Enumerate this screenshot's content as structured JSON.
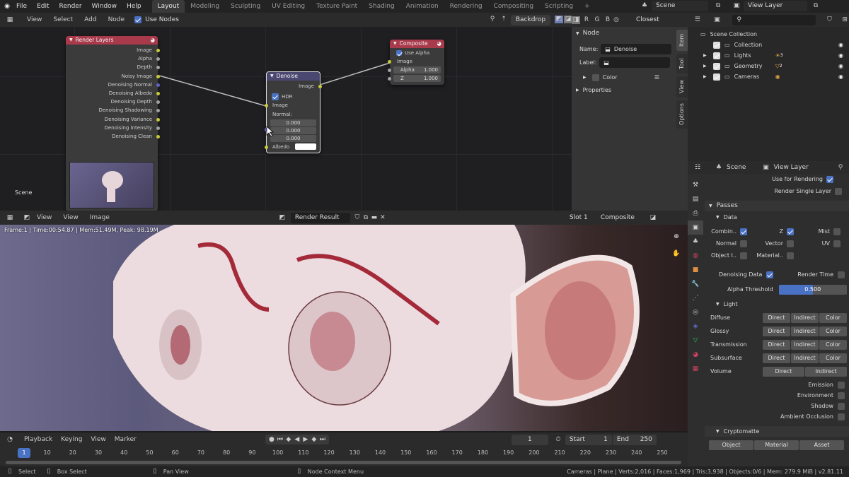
{
  "topbar": {
    "menus": [
      "File",
      "Edit",
      "Render",
      "Window",
      "Help"
    ],
    "workspaces": [
      "Layout",
      "Modeling",
      "Sculpting",
      "UV Editing",
      "Texture Paint",
      "Shading",
      "Animation",
      "Rendering",
      "Compositing",
      "Scripting"
    ],
    "active_workspace": "Layout",
    "add_tab": "+",
    "scene": "Scene",
    "view_layer": "View Layer"
  },
  "node_editor": {
    "header": {
      "menus": [
        "View",
        "Select",
        "Add",
        "Node"
      ],
      "use_nodes_label": "Use Nodes",
      "use_nodes": true,
      "backdrop_label": "Backdrop",
      "channels": [
        "R",
        "G",
        "B"
      ],
      "interpolation": "Closest"
    },
    "scene_label": "Scene",
    "render_layers": {
      "title": "Render Layers",
      "outputs": [
        {
          "label": "Image",
          "color": "yellow"
        },
        {
          "label": "Alpha",
          "color": "gray"
        },
        {
          "label": "Depth",
          "color": "gray"
        },
        {
          "label": "Noisy Image",
          "color": "yellow"
        },
        {
          "label": "Denoising Normal",
          "color": "blue"
        },
        {
          "label": "Denoising Albedo",
          "color": "yellow"
        },
        {
          "label": "Denoising Depth",
          "color": "gray"
        },
        {
          "label": "Denoising Shadowing",
          "color": "gray"
        },
        {
          "label": "Denoising Variance",
          "color": "yellow"
        },
        {
          "label": "Denoising Intensity",
          "color": "gray"
        },
        {
          "label": "Denoising Clean",
          "color": "yellow"
        }
      ]
    },
    "denoise": {
      "title": "Denoise",
      "output": "Image",
      "hdr_label": "HDR",
      "hdr": true,
      "image_label": "Image",
      "normal_label": "Normal:",
      "normal_values": [
        "0.000",
        "0.000",
        "0.000"
      ],
      "albedo_label": "Albedo"
    },
    "composite": {
      "title": "Composite",
      "use_alpha_label": "Use Alpha",
      "use_alpha": true,
      "image_label": "Image",
      "alpha_label": "Alpha",
      "alpha_value": "1.000",
      "z_label": "Z",
      "z_value": "1.000"
    }
  },
  "npanel": {
    "tabs": [
      "Item",
      "Tool",
      "View",
      "Options"
    ],
    "node_section": "Node",
    "name_label": "Name:",
    "name_value": "Denoise",
    "label_label": "Label:",
    "label_value": "",
    "color_label": "Color",
    "properties_label": "Properties"
  },
  "outliner": {
    "root": "Scene Collection",
    "items": [
      {
        "label": "Collection",
        "badge": ""
      },
      {
        "label": "Lights",
        "badge": "3"
      },
      {
        "label": "Geometry",
        "badge": "2"
      },
      {
        "label": "Cameras",
        "badge": ""
      }
    ]
  },
  "image_editor": {
    "menus": [
      "View",
      "View",
      "Image"
    ],
    "image_name": "Render Result",
    "slot": "Slot 1",
    "layer": "Composite",
    "info": "Frame:1 | Time:00:54.87 | Mem:51.49M, Peak: 98.19M"
  },
  "properties": {
    "scene_label": "Scene",
    "view_layer_label": "View Layer",
    "use_for_rendering_label": "Use for Rendering",
    "use_for_rendering": true,
    "render_single_layer_label": "Render Single Layer",
    "passes_label": "Passes",
    "data_label": "Data",
    "data_passes": [
      {
        "label": "Combin..",
        "on": true
      },
      {
        "label": "Z",
        "on": true
      },
      {
        "label": "Mist",
        "on": false
      },
      {
        "label": "Normal",
        "on": false
      },
      {
        "label": "Vector",
        "on": false
      },
      {
        "label": "UV",
        "on": false
      },
      {
        "label": "Object I..",
        "on": false
      },
      {
        "label": "Material..",
        "on": false
      }
    ],
    "denoising_data_label": "Denoising Data",
    "denoising_data": true,
    "render_time_label": "Render Time",
    "alpha_threshold_label": "Alpha Threshold",
    "alpha_threshold": "0.500",
    "alpha_threshold_fraction": 0.5,
    "light_label": "Light",
    "light_rows": [
      {
        "label": "Diffuse",
        "buttons": [
          "Direct",
          "Indirect",
          "Color"
        ]
      },
      {
        "label": "Glossy",
        "buttons": [
          "Direct",
          "Indirect",
          "Color"
        ]
      },
      {
        "label": "Transmission",
        "buttons": [
          "Direct",
          "Indirect",
          "Color"
        ]
      },
      {
        "label": "Subsurface",
        "buttons": [
          "Direct",
          "Indirect",
          "Color"
        ]
      },
      {
        "label": "Volume",
        "buttons": [
          "Direct",
          "Indirect"
        ]
      }
    ],
    "light_checks": [
      "Emission",
      "Environment",
      "Shadow",
      "Ambient Occlusion"
    ],
    "cryptomatte_label": "Cryptomatte",
    "crypto_buttons": [
      "Object",
      "Material",
      "Asset"
    ]
  },
  "timeline": {
    "menus": [
      "Playback",
      "Keying",
      "View",
      "Marker"
    ],
    "current_frame": "1",
    "start_label": "Start",
    "start": "1",
    "end_label": "End",
    "end": "250",
    "ticks": [
      "1",
      "10",
      "20",
      "30",
      "40",
      "50",
      "60",
      "70",
      "80",
      "90",
      "100",
      "110",
      "120",
      "130",
      "140",
      "150",
      "160",
      "170",
      "180",
      "190",
      "200",
      "210",
      "220",
      "230",
      "240",
      "250"
    ]
  },
  "statusbar": {
    "select": "Select",
    "box_select": "Box Select",
    "pan_view": "Pan View",
    "context_menu": "Node Context Menu",
    "stats": "Cameras | Plane | Verts:2,016 | Faces:1,969 | Tris:3,938 | Objects:0/6 | Mem: 279.9 MiB | v2.81.11"
  },
  "colors": {
    "accent": "#4a72c4",
    "node_red": "#a83a4b",
    "socket_yellow": "#c7cb3a"
  }
}
